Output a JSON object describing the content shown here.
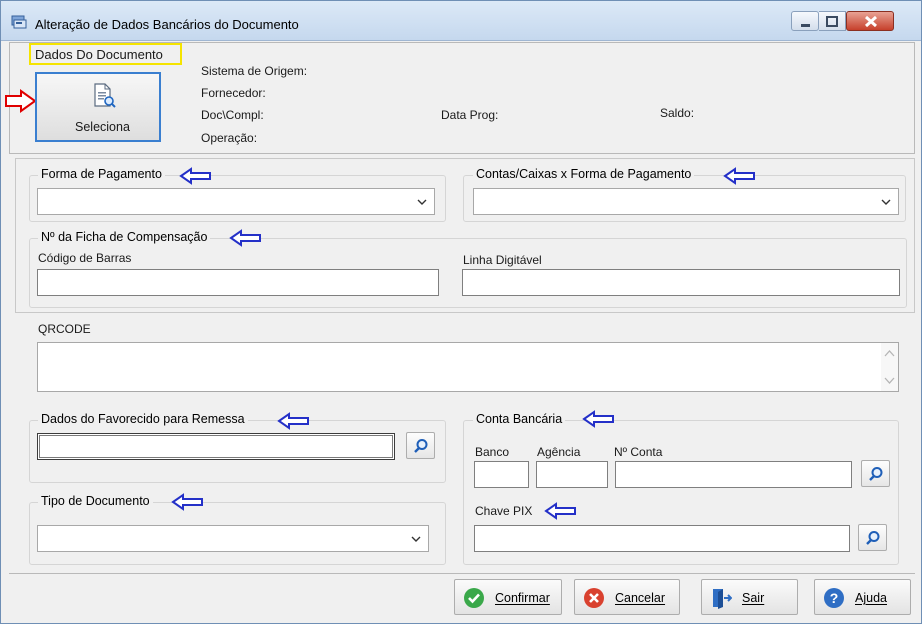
{
  "window": {
    "title": "Alteração de Dados Bancários do Documento"
  },
  "document": {
    "group_title": "Dados Do Documento",
    "select_button": "Seleciona",
    "sistema_origem_label": "Sistema de Origem:",
    "fornecedor_label": "Fornecedor:",
    "doc_compl_label": "Doc\\Compl:",
    "operacao_label": "Operação:",
    "data_prog_label": "Data Prog:",
    "saldo_label": "Saldo:"
  },
  "payment": {
    "forma_pagamento_title": "Forma de Pagamento",
    "forma_pagamento_value": "",
    "contas_caixas_title": "Contas/Caixas x Forma de Pagamento",
    "contas_caixas_value": ""
  },
  "ficha": {
    "title": "Nº da Ficha de Compensação",
    "codigo_barras_label": "Código de Barras",
    "codigo_barras_value": "",
    "linha_digitavel_label": "Linha Digitável",
    "linha_digitavel_value": ""
  },
  "qrcode": {
    "label": "QRCODE",
    "value": ""
  },
  "favorecido": {
    "title": "Dados do Favorecido para Remessa",
    "value": ""
  },
  "tipo_documento": {
    "title": "Tipo de Documento",
    "value": ""
  },
  "conta_bancaria": {
    "title": "Conta Bancária",
    "banco_label": "Banco",
    "agencia_label": "Agência",
    "conta_label": "Nº Conta",
    "chave_pix_label": "Chave PIX",
    "banco_value": "",
    "agencia_value": "",
    "conta_value": "",
    "chave_pix_value": ""
  },
  "footer": {
    "confirmar": "Confirmar",
    "cancelar": "Cancelar",
    "sair": "Sair",
    "ajuda": "Ajuda"
  },
  "colors": {
    "annotation_yellow": "#f5e400",
    "annotation_red": "#e00000",
    "annotation_blue": "#2430c8",
    "focus_blue": "#3a7fd0"
  },
  "icons": [
    "document-search-icon",
    "search-icon",
    "chevron-down-icon",
    "check-icon",
    "cancel-icon",
    "exit-icon",
    "help-icon",
    "arrow-left-annotation-icon",
    "arrow-right-annotation-icon"
  ]
}
